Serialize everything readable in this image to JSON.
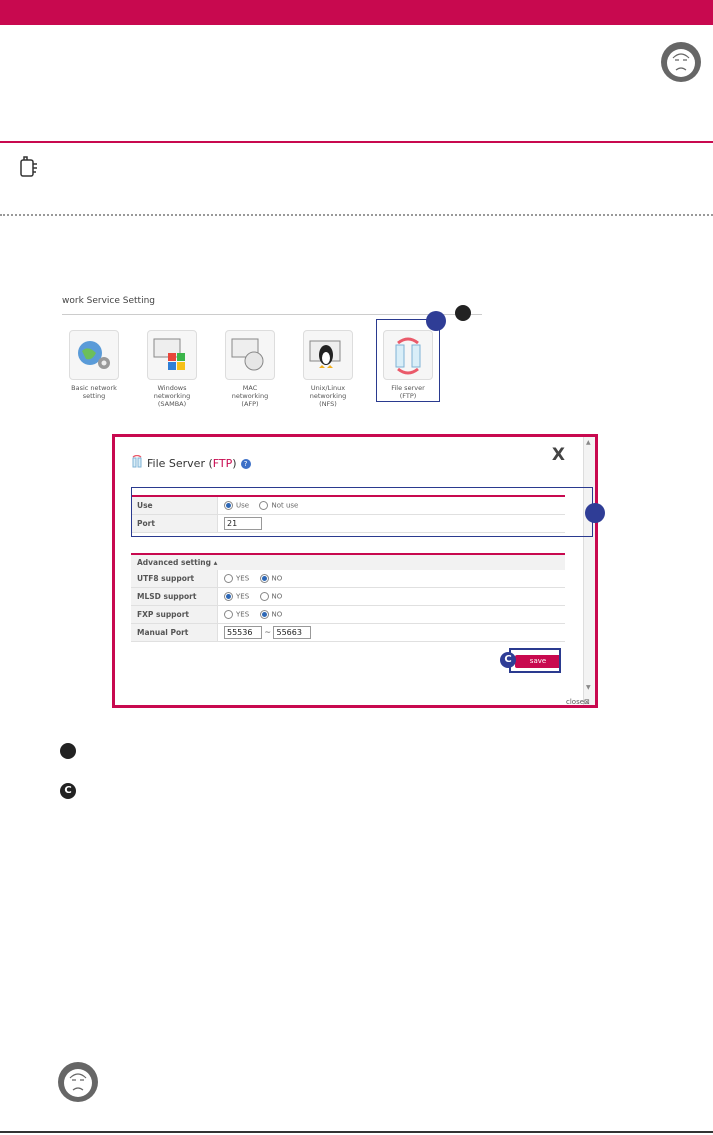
{
  "network_service": {
    "title": "work Service Setting",
    "items": [
      {
        "label": "Basic network\nsetting"
      },
      {
        "label": "Windows\nnetworking\n(SAMBA)"
      },
      {
        "label": "MAC\nnetworking\n(AFP)"
      },
      {
        "label": "Unix/Linux\nnetworking\n(NFS)"
      },
      {
        "label": "File server\n(FTP)"
      }
    ]
  },
  "dialog": {
    "title_prefix": "File Server (",
    "title_ftp": "FTP",
    "title_suffix": ")",
    "help_icon": "?",
    "close_x": "X",
    "rows": {
      "use_label": "Use",
      "use_option": "Use",
      "not_use_option": "Not use",
      "port_label": "Port",
      "port_value": "21"
    },
    "advanced_label": "Advanced setting ▴",
    "advanced": {
      "utf8_label": "UTF8 support",
      "mlsd_label": "MLSD support",
      "fxp_label": "FXP support",
      "manual_port_label": "Manual Port",
      "yes": "YES",
      "no": "NO",
      "port_from": "55536",
      "port_sep": "~",
      "port_to": "55663"
    },
    "save_label": "save",
    "close_label": "close"
  },
  "markers": {
    "c_label": "C"
  },
  "colors": {
    "brand": "#c8094f",
    "marker_blue": "#2f3d96"
  }
}
